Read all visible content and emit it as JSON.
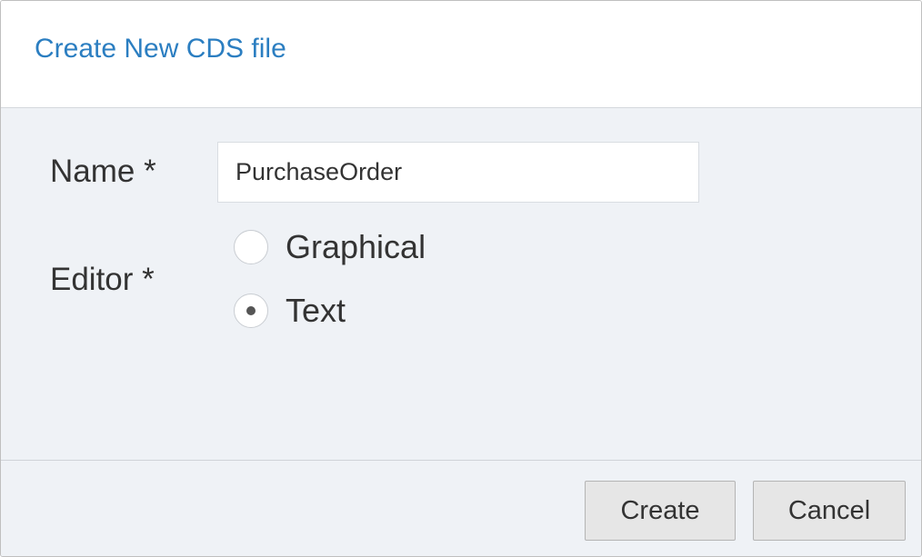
{
  "dialog": {
    "title": "Create New CDS file",
    "name_field": {
      "label": "Name *",
      "value": "PurchaseOrder"
    },
    "editor_field": {
      "label": "Editor *",
      "options": [
        {
          "label": "Graphical",
          "selected": false
        },
        {
          "label": "Text",
          "selected": true
        }
      ]
    },
    "buttons": {
      "create_label": "Create",
      "cancel_label": "Cancel"
    }
  },
  "colors": {
    "title": "#2b7ec1",
    "body_background": "#eff2f6",
    "button_background": "#e6e6e6"
  }
}
